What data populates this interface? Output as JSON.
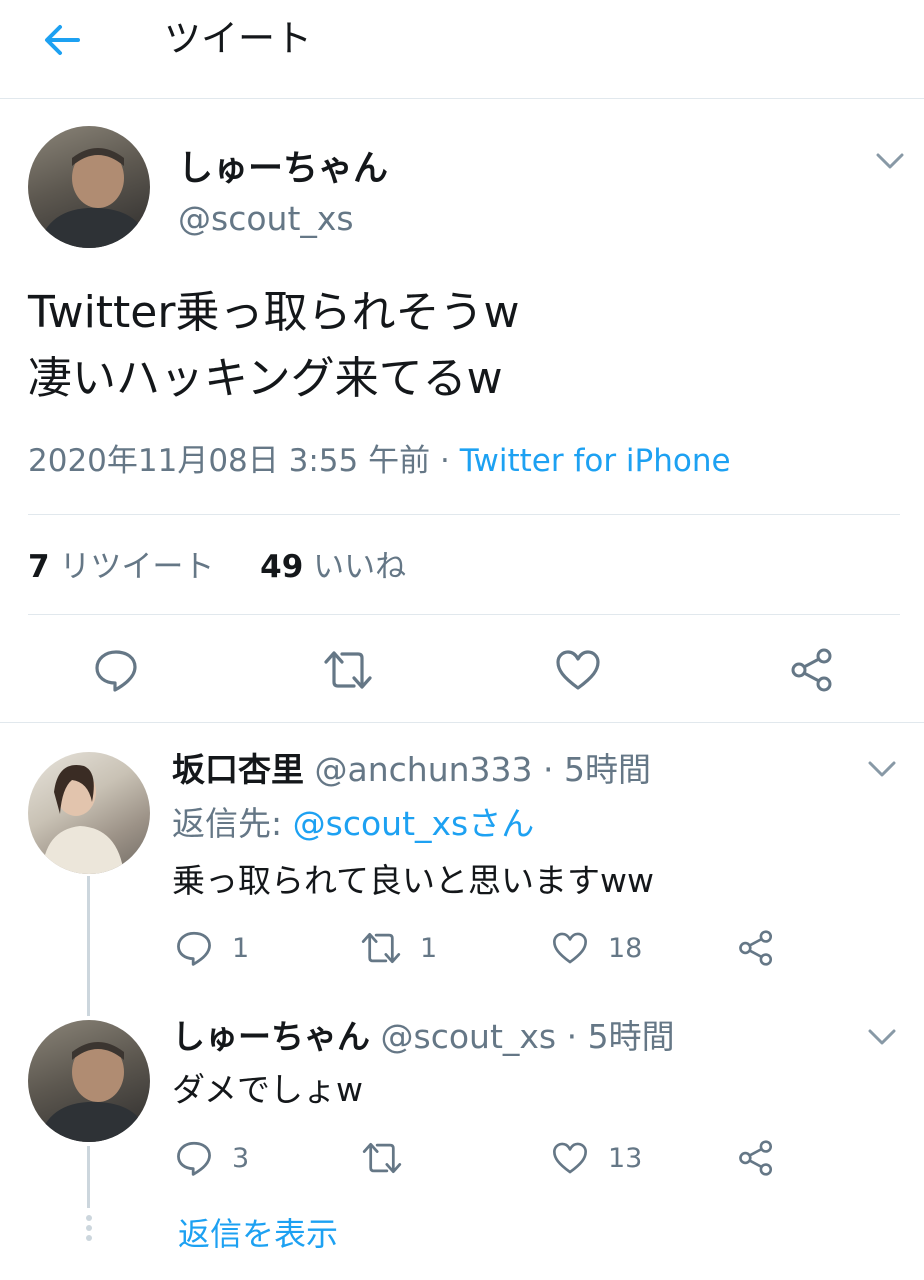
{
  "header": {
    "title": "ツイート"
  },
  "main_tweet": {
    "name": "しゅーちゃん",
    "handle": "@scout_xs",
    "text_line1": "Twitter乗っ取られそうw",
    "text_line2": "凄いハッキング来てるw",
    "timestamp": "2020年11月08日 3:55 午前",
    "separator": "·",
    "source": "Twitter for iPhone",
    "retweet_count": "7",
    "retweet_label": "リツイート",
    "like_count": "49",
    "like_label": "いいね"
  },
  "replies": [
    {
      "name": "坂口杏里",
      "handle": "@anchun333",
      "time": "· 5時間",
      "reply_to_label": "返信先:",
      "reply_to_handle": "@scout_xsさん",
      "text": "乗っ取られて良いと思いますww",
      "reply_count": "1",
      "retweet_count": "1",
      "like_count": "18"
    },
    {
      "name": "しゅーちゃん",
      "handle": "@scout_xs",
      "time": "· 5時間",
      "text": "ダメでしょw",
      "reply_count": "3",
      "like_count": "13"
    }
  ],
  "show_replies_label": "返信を表示",
  "colors": {
    "accent": "#1da1f2",
    "secondary_text": "#657786",
    "divider": "#e1e8ed"
  },
  "icons": [
    "back-arrow-icon",
    "chevron-down-icon",
    "reply-icon",
    "retweet-icon",
    "like-icon",
    "share-icon"
  ]
}
